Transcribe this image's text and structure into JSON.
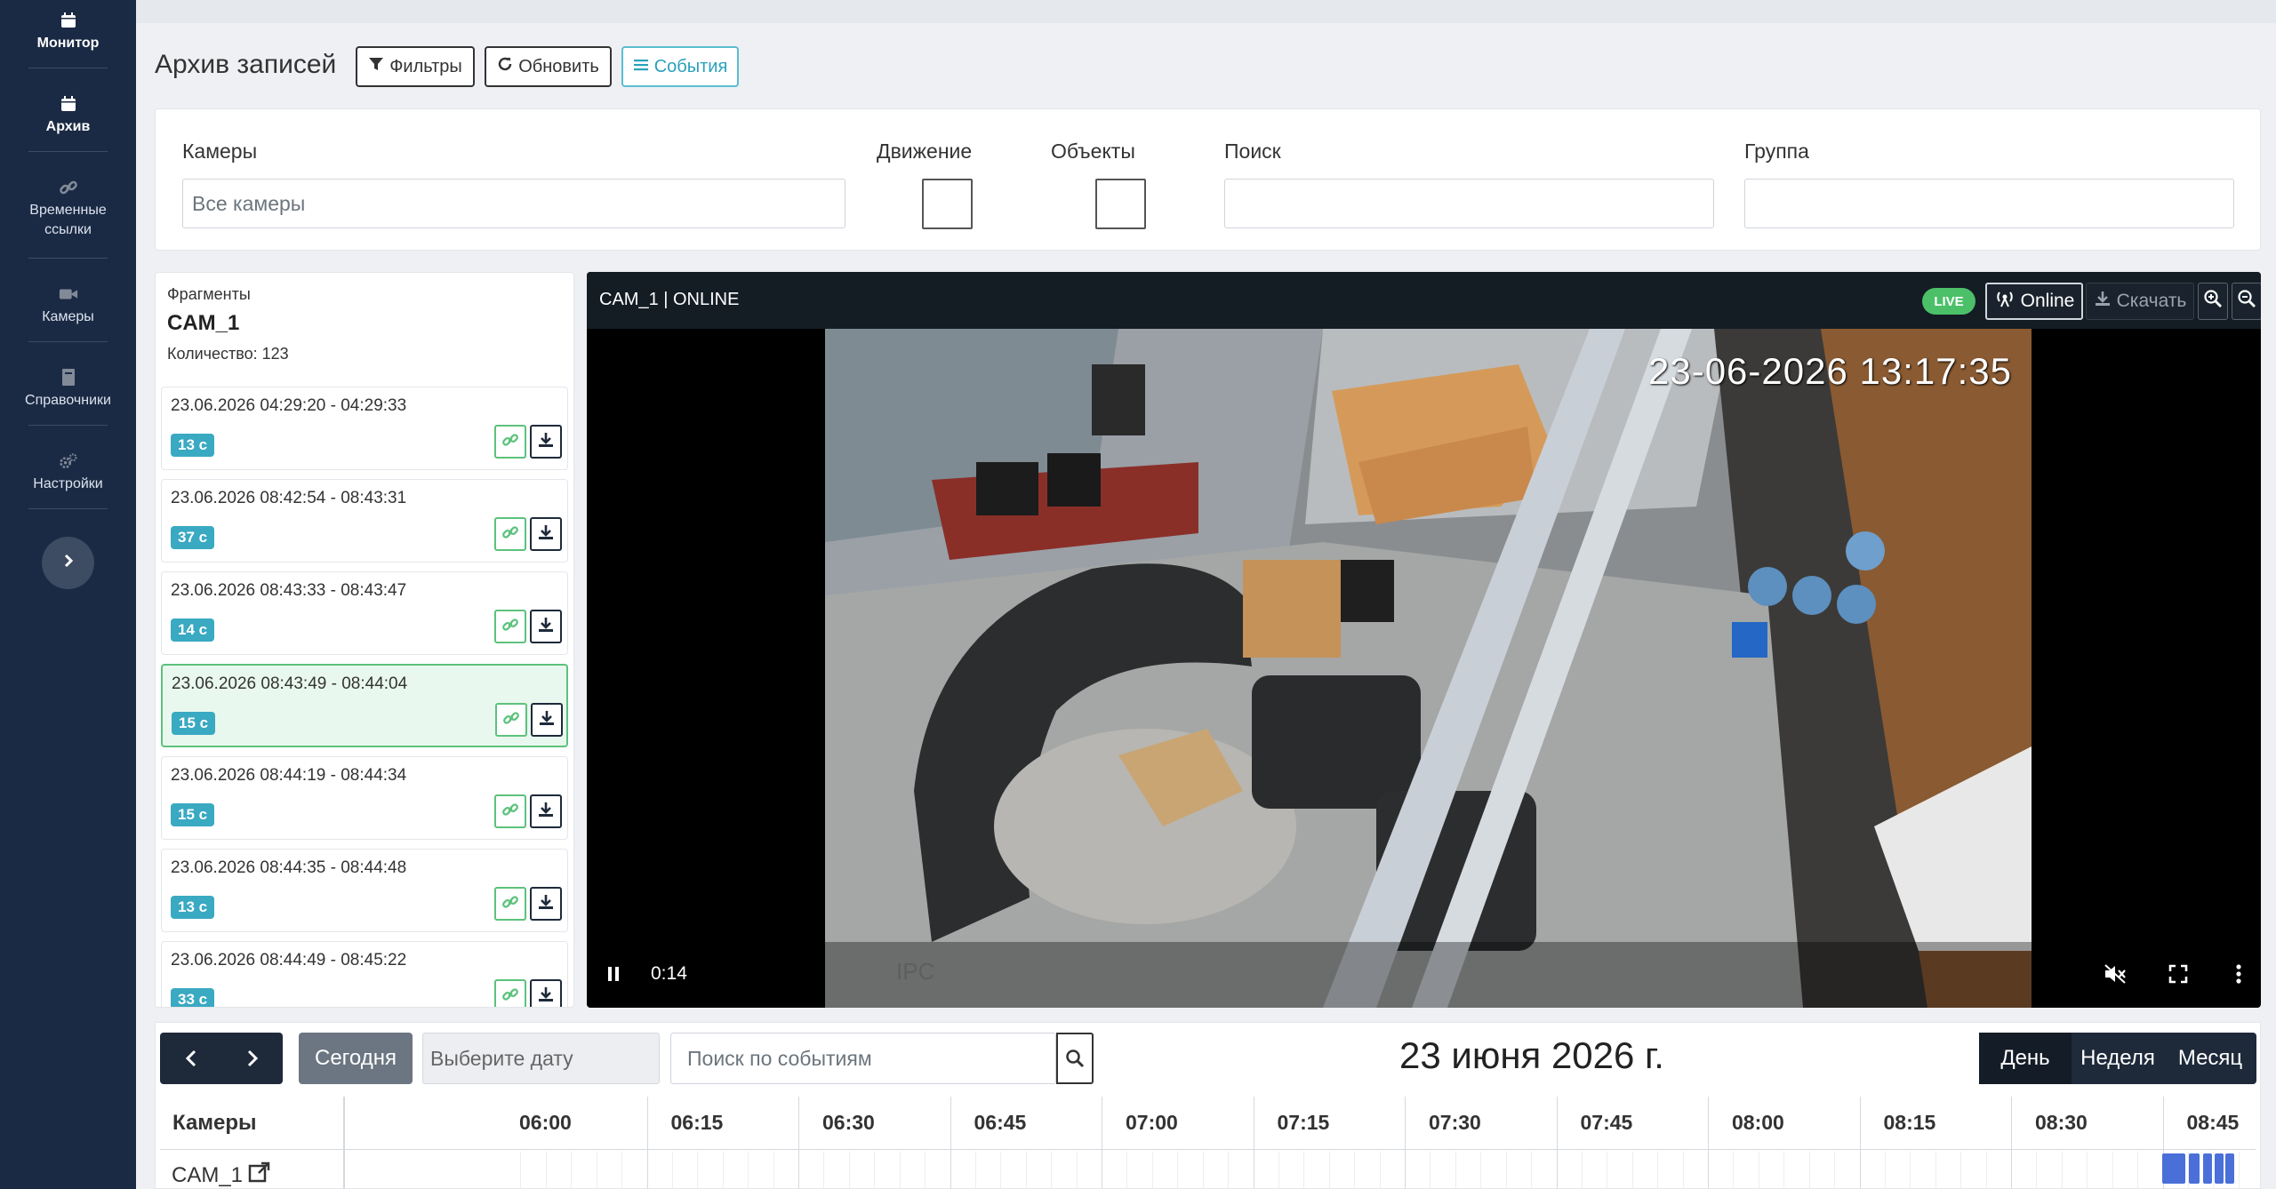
{
  "sidebar": {
    "items": [
      {
        "label": "Монитор",
        "icon": "calendar-icon"
      },
      {
        "label": "Архив",
        "icon": "calendar-icon"
      },
      {
        "label": "Временные ссылки",
        "icon": "link-icon"
      },
      {
        "label": "Камеры",
        "icon": "video-camera-icon"
      },
      {
        "label": "Справочники",
        "icon": "book-icon"
      },
      {
        "label": "Настройки",
        "icon": "cogs-icon"
      }
    ],
    "collapse_icon": "chevron-right-icon"
  },
  "header": {
    "title": "Архив записей",
    "filters_label": "Фильтры",
    "refresh_label": "Обновить",
    "events_label": "События"
  },
  "filters": {
    "cameras_label": "Камеры",
    "cameras_placeholder": "Все камеры",
    "motion_label": "Движение",
    "objects_label": "Объекты",
    "search_label": "Поиск",
    "group_label": "Группа"
  },
  "fragments": {
    "heading": "Фрагменты",
    "camera": "CAM_1",
    "count_text": "Количество: 123",
    "items": [
      {
        "time": "23.06.2026 04:29:20 - 04:29:33",
        "duration": "13 с",
        "selected": false
      },
      {
        "time": "23.06.2026 08:42:54 - 08:43:31",
        "duration": "37 с",
        "selected": false
      },
      {
        "time": "23.06.2026 08:43:33 - 08:43:47",
        "duration": "14 с",
        "selected": false
      },
      {
        "time": "23.06.2026 08:43:49 - 08:44:04",
        "duration": "15 с",
        "selected": true
      },
      {
        "time": "23.06.2026 08:44:19 - 08:44:34",
        "duration": "15 с",
        "selected": false
      },
      {
        "time": "23.06.2026 08:44:35 - 08:44:48",
        "duration": "13 с",
        "selected": false
      },
      {
        "time": "23.06.2026 08:44:49 - 08:45:22",
        "duration": "33 с",
        "selected": false
      }
    ]
  },
  "video": {
    "title": "CAM_1 | ONLINE",
    "live_badge": "LIVE",
    "online_label": "Online",
    "download_label": "Скачать",
    "timestamp_overlay": "23-06-2026 13:17:35",
    "current_time": "0:14",
    "watermark": "IPC"
  },
  "calendar": {
    "today_label": "Сегодня",
    "date_placeholder": "Выберите дату",
    "event_search_placeholder": "Поиск по событиям",
    "title": "23 июня 2026 г.",
    "views": [
      "День",
      "Неделя",
      "Месяц"
    ],
    "active_view": "День",
    "cameras_header": "Камеры",
    "hours": [
      "06:00",
      "06:15",
      "06:30",
      "06:45",
      "07:00",
      "07:15",
      "07:30",
      "07:45",
      "08:00",
      "08:15",
      "08:30",
      "08:45"
    ],
    "rows": [
      {
        "camera": "CAM_1"
      }
    ]
  },
  "colors": {
    "sidebar_bg": "#1b2a44",
    "accent_green": "#5cc27c",
    "badge_teal": "#3aa9c2",
    "recording_blue": "#4a6fd8"
  }
}
